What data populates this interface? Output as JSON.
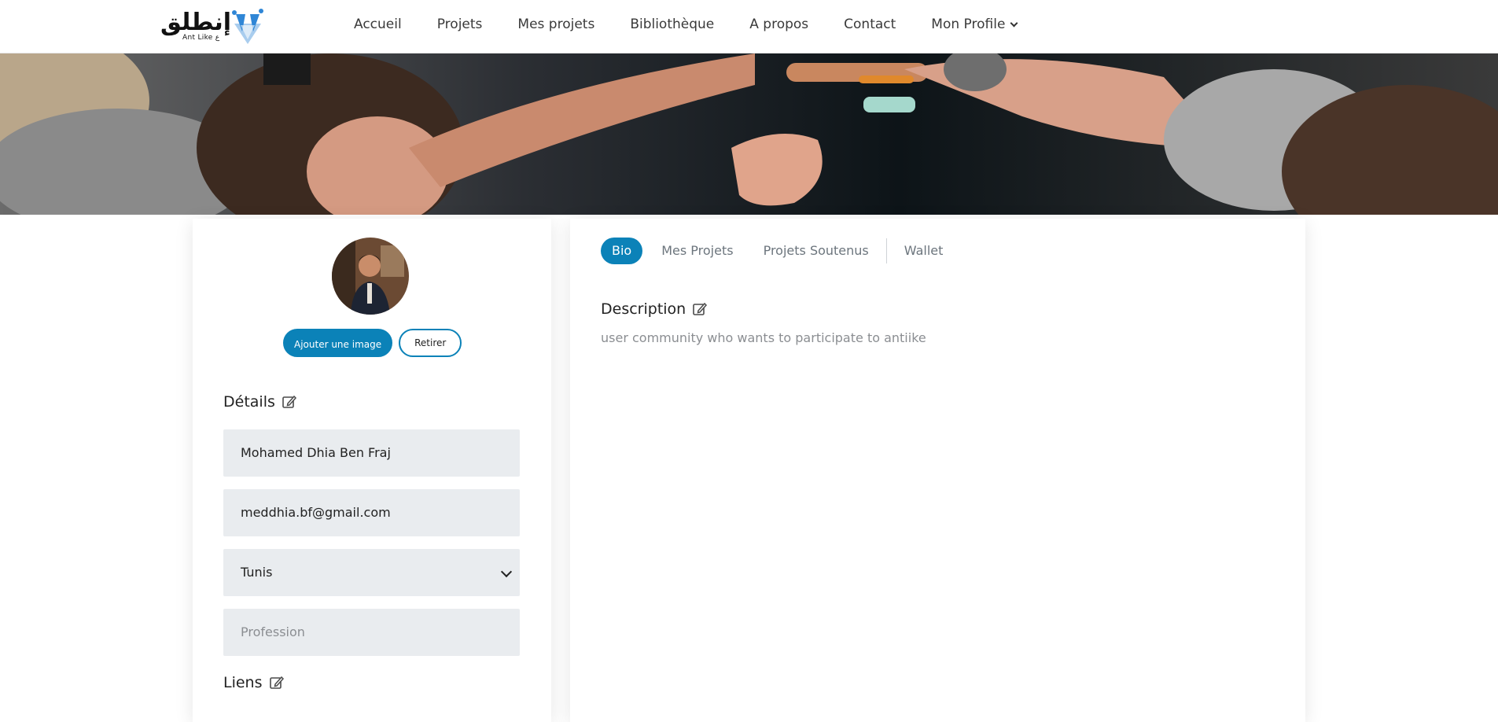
{
  "brand": {
    "logo_arabic": "إنطلق",
    "logo_sub": "Ant Like ع"
  },
  "nav": {
    "items": [
      {
        "label": "Accueil"
      },
      {
        "label": "Projets"
      },
      {
        "label": "Mes projets"
      },
      {
        "label": "Bibliothèque"
      },
      {
        "label": "A propos"
      },
      {
        "label": "Contact"
      },
      {
        "label": "Mon Profile"
      }
    ]
  },
  "profile": {
    "add_image_label": "Ajouter une image",
    "remove_label": "Retirer",
    "details_title": "Détails",
    "name_value": "Mohamed Dhia Ben Fraj",
    "email_value": "meddhia.bf@gmail.com",
    "city_value": "Tunis",
    "profession_placeholder": "Profession",
    "links_title": "Liens"
  },
  "tabs": [
    {
      "label": "Bio",
      "active": true
    },
    {
      "label": "Mes Projets",
      "active": false
    },
    {
      "label": "Projets Soutenus",
      "active": false
    },
    {
      "label": "Wallet",
      "active": false
    }
  ],
  "bio": {
    "description_title": "Description",
    "description_text": "user community who wants to participate to antiike"
  },
  "colors": {
    "accent": "#0b82b8",
    "field_bg": "#e9ecef",
    "muted_text": "#8b8e92"
  },
  "icons": {
    "edit": "edit-icon",
    "dropdown": "chevron-down-icon"
  }
}
